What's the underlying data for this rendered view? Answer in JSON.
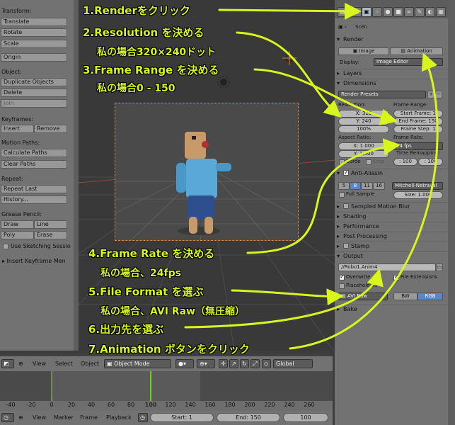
{
  "colors": {
    "annotation": "#d8f51e",
    "accent_blue": "#5b85c6"
  },
  "tool_shelf": {
    "transform_header": "Transform:",
    "translate": "Translate",
    "rotate": "Rotate",
    "scale": "Scale",
    "origin": "Origin",
    "object_header": "Object:",
    "duplicate_objects": "Duplicate Objects",
    "delete": "Delete",
    "join": "Join",
    "keyframes_header": "Keyframes:",
    "insert": "Insert",
    "remove": "Remove",
    "motion_paths_header": "Motion Paths:",
    "calculate_paths": "Calculate Paths",
    "clear_paths": "Clear Paths",
    "repeat_header": "Repeat:",
    "repeat_last": "Repeat Last",
    "history": "History...",
    "grease_pencil_header": "Grease Pencil:",
    "draw": "Draw",
    "line": "Line",
    "poly": "Poly",
    "erase": "Erase",
    "use_sketching_session": "Use Sketching Sessio",
    "insert_keyframe_menu": "Insert Keyframe Men"
  },
  "properties": {
    "scene_label": "Scen",
    "render_panel": "Render",
    "image_button": "Image",
    "animation_button": "Animation",
    "display_label": "Display:",
    "display_value": "Image Editor",
    "layers_panel": "Layers",
    "dimensions_panel": "Dimensions",
    "render_presets": "Render Presets",
    "resolution_label": "Resolution:",
    "res_x": "X: 320",
    "res_y": "Y: 240",
    "res_percent": "100%",
    "frame_range_label": "Frame Range:",
    "start_frame": "Start Frame: 1",
    "end_frame": "End Frame: 150",
    "frame_step": "Frame Step: 1",
    "aspect_ratio_label": "Aspect Ratio:",
    "aspect_x": "X: 1.000",
    "aspect_y": "Y: 1.000",
    "frame_rate_label": "Frame Rate:",
    "frame_rate_value": "24 fps",
    "time_remapping_label": "Time Remapping:",
    "remap_old": ": 100",
    "remap_new": ": 100",
    "border": "Borde",
    "crop": "Crop",
    "anti_aliasing_panel": "Anti-Aliasin",
    "aa_samples": [
      "5",
      "8",
      "11",
      "16"
    ],
    "aa_filter": "Mitchell-Netraval",
    "full_sample": "Full Sample",
    "aa_size": "Size: 1.000",
    "sampled_motion_blur_panel": "Sampled Motion Blur",
    "shading_panel": "Shading",
    "performance_panel": "Performance",
    "post_processing_panel": "Post Processing",
    "stamp_panel": "Stamp",
    "output_panel": "Output",
    "output_path": "//Robo1.Anim4",
    "overwrite": "Overwrite",
    "file_extensions": "File Extensions",
    "placeholders": "Placeholders",
    "file_format": "AVI Raw",
    "bw": "BW",
    "rgb": "RGB",
    "bake_panel": "Bake"
  },
  "timeline": {
    "view_menu": "View",
    "select_menu": "Select",
    "object_menu": "Object",
    "mode_value": "Object Mode",
    "orientation_value": "Global",
    "ruler_ticks": [
      "-40",
      "-20",
      "0",
      "20",
      "40",
      "60",
      "80",
      "100",
      "120",
      "140",
      "160",
      "180",
      "200",
      "220",
      "240",
      "260"
    ],
    "footer_view": "View",
    "footer_marker": "Marker",
    "footer_frame": "Frame",
    "footer_playback": "Playback",
    "start_field": "Start: 1",
    "end_field": "End: 150",
    "current_frame": "100"
  },
  "annotations": {
    "step1": "1.Renderをクリック",
    "step2": "2.Resolution を決める",
    "step2_note": "私の場合320×240ドット",
    "step3": "3.Frame Range を決める",
    "step3_note": "私の場合0 - 150",
    "step4": "4.Frame Rate を決める",
    "step4_note": "私の場合、24fps",
    "step5": "5.File Format を選ぶ",
    "step5_note": "私の場合、AVI Raw（無圧縮）",
    "step6": "6.出力先を選ぶ",
    "step7": "7.Animation ボタンをクリック"
  }
}
